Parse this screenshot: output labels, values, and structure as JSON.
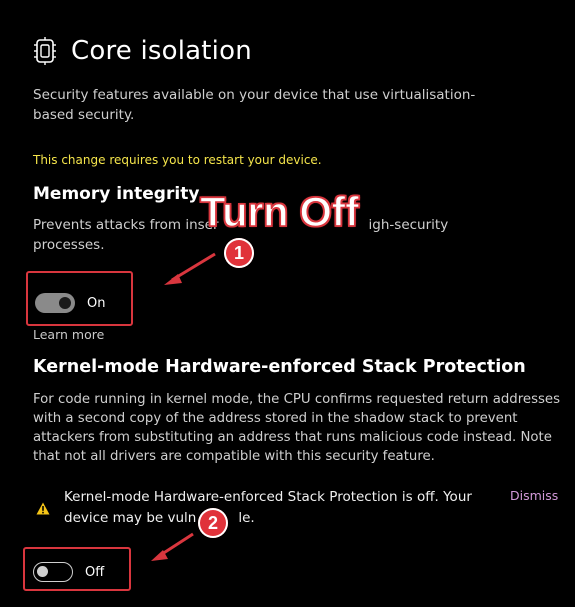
{
  "header": {
    "title": "Core isolation",
    "description": "Security features available on your device that use virtualisation-based security."
  },
  "restart_notice": "This change requires you to restart your device.",
  "memory_integrity": {
    "title": "Memory integrity",
    "description_visible_start": "Prevents attacks from inser",
    "description_visible_end": "igh-security",
    "description_line2": "processes.",
    "toggle_state_label": "On",
    "toggle_on": true,
    "learn_more": "Learn more"
  },
  "kernel_stack": {
    "title": "Kernel-mode Hardware-enforced Stack Protection",
    "description": "For code running in kernel mode, the CPU confirms requested return addresses with a second copy of the address stored in the shadow stack to prevent attackers from substituting an address that runs malicious code instead. Note that not all drivers are compatible with this security feature.",
    "alert_line1": "Kernel-mode Hardware-enforced Stack Protection is off. Your",
    "alert_line2_start": "device may be vuln",
    "alert_line2_end": "le.",
    "dismiss_label": "Dismiss",
    "toggle_state_label": "Off",
    "toggle_on": false
  },
  "annotations": {
    "callout_text": "Turn Off",
    "badge1": "1",
    "badge2": "2"
  },
  "colors": {
    "background": "#000000",
    "warning_yellow": "#f5e54b",
    "annotation_red": "#d9363e",
    "dismiss_pink": "#d39ad9"
  }
}
